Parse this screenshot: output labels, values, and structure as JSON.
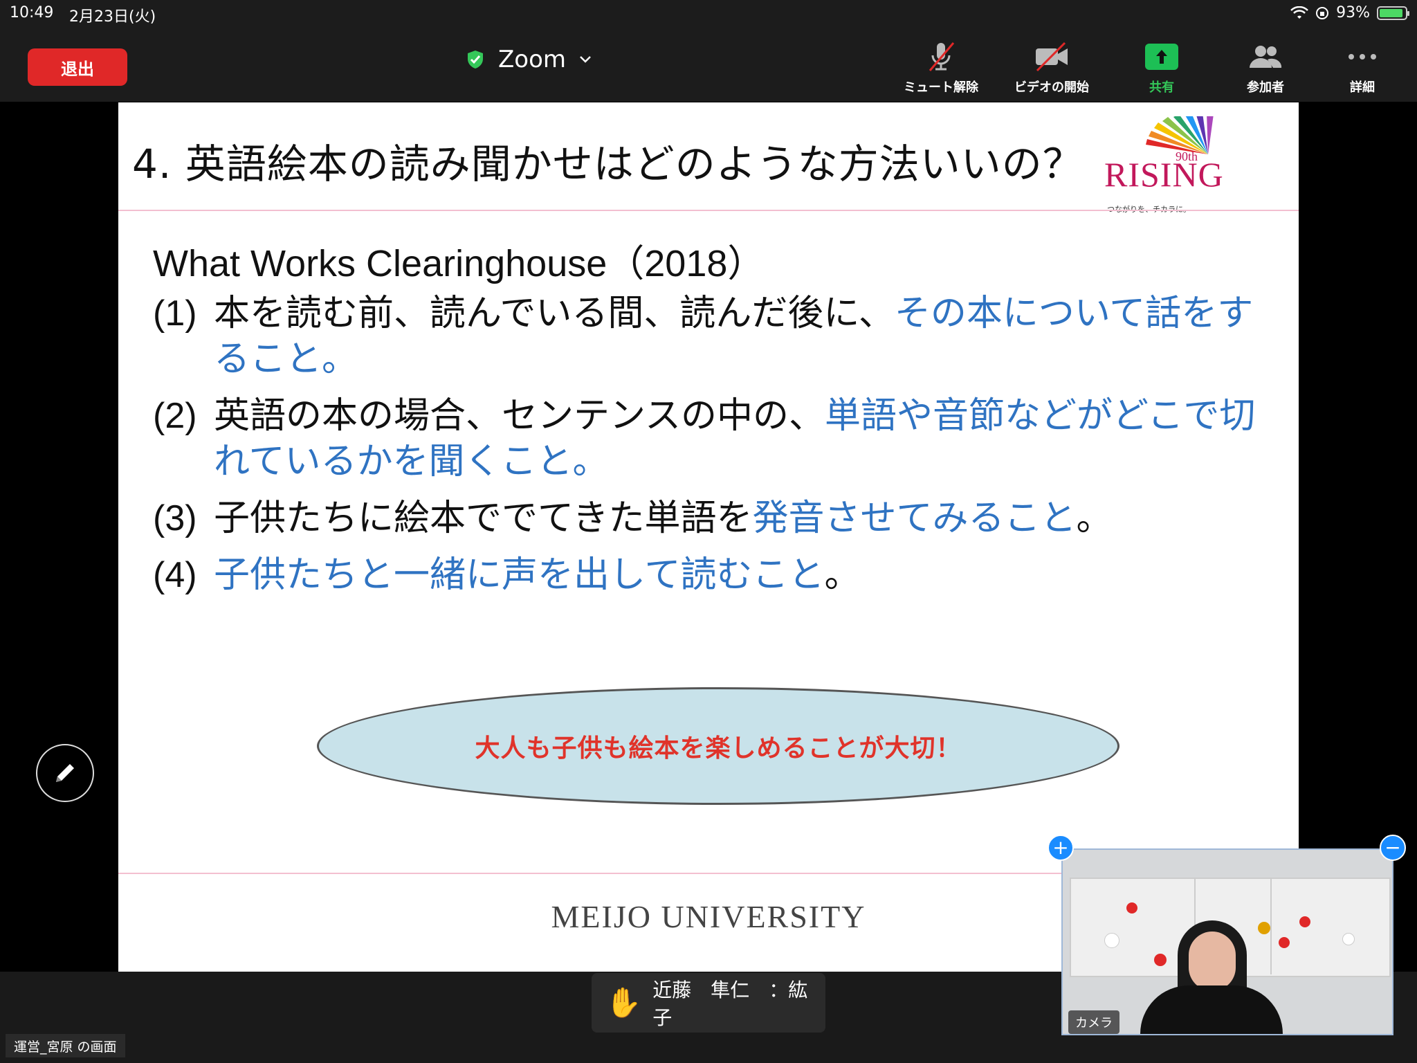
{
  "status": {
    "time": "10:49",
    "date": "2月23日(火)",
    "battery_percent": "93%",
    "battery_level": 0.93
  },
  "toolbar": {
    "leave_label": "退出",
    "meeting_title": "Zoom",
    "unmute_label": "ミュート解除",
    "video_label": "ビデオの開始",
    "share_label": "共有",
    "participants_label": "参加者",
    "more_label": "詳細"
  },
  "slide": {
    "title": "4. 英語絵本の読み聞かせはどのような方法いいの？",
    "logo_text": "RISING",
    "logo_90": "90th",
    "logo_sub": "つながりを、チカラに。",
    "heading": "What Works Clearinghouse（2018）",
    "items": [
      {
        "num": "(1)",
        "plain": "本を読む前、読んでいる間、読んだ後に、",
        "blue": "その本について話をすること",
        "end": "。"
      },
      {
        "num": "(2)",
        "plain": " 英語の本の場合、センテンスの中の、",
        "blue": "単語や音節などがどこで切れているかを聞くこと",
        "end": "。"
      },
      {
        "num": "(3)",
        "plain": "子供たちに絵本ででてきた単語を",
        "blue": "発音させてみること",
        "end": "。"
      },
      {
        "num": "(4)",
        "plain": "",
        "blue": "子供たちと一緒に声を出して読むこと",
        "end": "。"
      }
    ],
    "callout": "大人も子供も絵本を楽しめることが大切！",
    "footer": "MEIJO  UNIVERSITY"
  },
  "bottom": {
    "hand_names": "近藤　隼仁　：紘子",
    "screen_label": "運営_宮原 の画面",
    "camera_label": "カメラ"
  },
  "colors": {
    "leave": "#e02828",
    "share": "#1dbf55",
    "blue_text": "#2f73c2",
    "callout_text": "#e0332a",
    "callout_fill": "#c8e2ea"
  }
}
